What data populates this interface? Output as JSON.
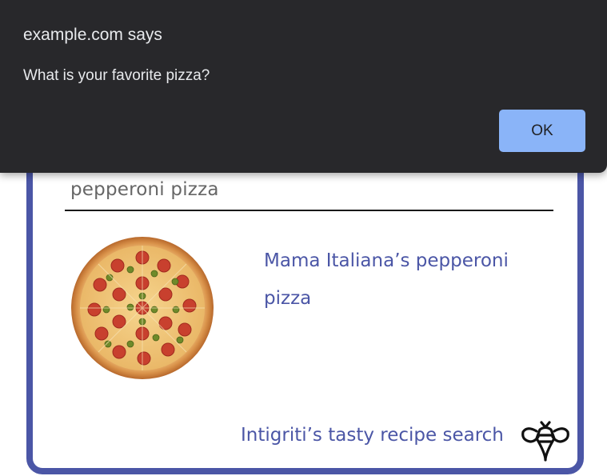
{
  "dialog": {
    "origin": "example.com says",
    "message": "What is your favorite pizza?",
    "ok_label": "OK",
    "button_color": "#8ab4f8",
    "background_color": "#28282b"
  },
  "search": {
    "value": "pepperoni pizza"
  },
  "result": {
    "title_line1": "Mama Italiana’s pepperoni",
    "title_line2": "pizza",
    "image": "pepperoni-pizza-image"
  },
  "footer": {
    "title": "Intigriti’s tasty recipe search",
    "logo": "bee-logo-icon"
  },
  "theme": {
    "accent": "#4b56a6"
  }
}
